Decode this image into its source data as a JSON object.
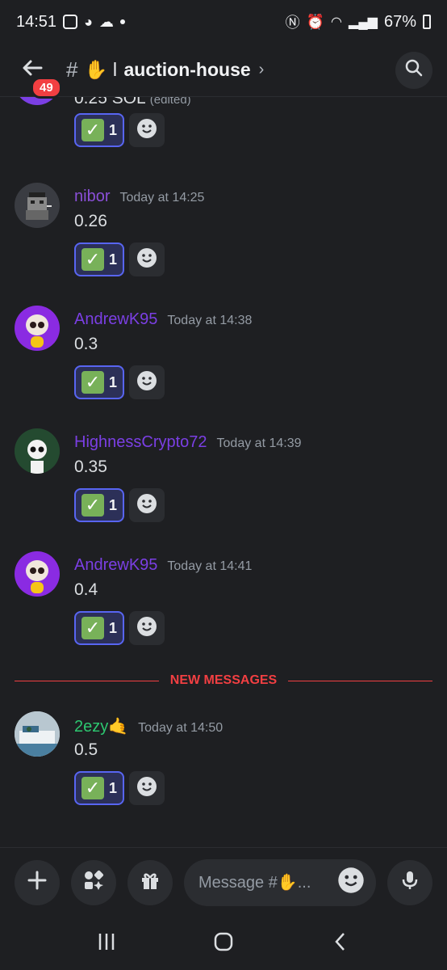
{
  "status_bar": {
    "time": "14:51",
    "battery": "67%"
  },
  "header": {
    "badge": "49",
    "channel_name": "auction-house",
    "channel_prefix": "✋ ǀ"
  },
  "messages": [
    {
      "partial": true,
      "content": "0.25 SOL",
      "edited": "(edited)",
      "reaction_count": "1"
    },
    {
      "author": "nibor",
      "author_color": "#8a4fd8",
      "time": "Today at 14:25",
      "content": "0.26",
      "reaction_count": "1",
      "avatar": "pixel-bear"
    },
    {
      "author": "AndrewK95",
      "author_color": "#7b3fe4",
      "time": "Today at 14:38",
      "content": "0.3",
      "reaction_count": "1",
      "avatar": "skull-purple"
    },
    {
      "author": "HighnessCrypto72",
      "author_color": "#7b3fe4",
      "time": "Today at 14:39",
      "content": "0.35",
      "reaction_count": "1",
      "avatar": "skull-forest"
    },
    {
      "author": "AndrewK95",
      "author_color": "#7b3fe4",
      "time": "Today at 14:41",
      "content": "0.4",
      "reaction_count": "1",
      "avatar": "skull-purple"
    },
    {
      "author": "2ezy🤙",
      "author_color": "#2dc770",
      "time": "Today at 14:50",
      "content": "0.5",
      "reaction_count": "1",
      "avatar": "boat"
    }
  ],
  "divider": {
    "label": "NEW MESSAGES"
  },
  "composer": {
    "placeholder": "Message #✋..."
  },
  "colors": {
    "accent": "#5865f2",
    "new_messages": "#f23f42",
    "background": "#1e1f22"
  }
}
